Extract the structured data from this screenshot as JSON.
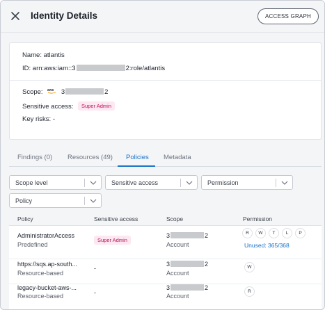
{
  "header": {
    "title": "Identity Details",
    "access_graph_label": "ACCESS GRAPH"
  },
  "identity": {
    "name_label": "Name:",
    "name_value": "atlantis",
    "id_label": "ID:",
    "id_prefix": "arn:aws:iam::3",
    "id_suffix": "2:role/atlantis",
    "scope_label": "Scope:",
    "scope_prefix": "3",
    "scope_suffix": "2",
    "sensitive_label": "Sensitive access:",
    "sensitive_badge": "Super Admin",
    "risks_label": "Key risks:",
    "risks_value": "-"
  },
  "tabs": [
    {
      "label": "Findings (0)",
      "active": false
    },
    {
      "label": "Resources (49)",
      "active": false
    },
    {
      "label": "Policies",
      "active": true
    },
    {
      "label": "Metadata",
      "active": false
    }
  ],
  "filters": [
    {
      "label": "Scope level"
    },
    {
      "label": "Sensitive access"
    },
    {
      "label": "Permission"
    },
    {
      "label": "Policy"
    }
  ],
  "table": {
    "columns": [
      "Policy",
      "Sensitive access",
      "Scope",
      "Permission"
    ],
    "rows": [
      {
        "policy": "AdministratorAccess",
        "type": "Predefined",
        "sensitive": "Super Admin",
        "scope_prefix": "3",
        "scope_suffix": "2",
        "scope_type": "Account",
        "permissions": [
          "R",
          "W",
          "T",
          "L",
          "P"
        ],
        "unused": "Unused: 365/368"
      },
      {
        "policy": "https://sqs.ap-south...",
        "type": "Resource-based",
        "sensitive": "-",
        "scope_prefix": "3",
        "scope_suffix": "2",
        "scope_type": "Account",
        "permissions": [
          "W"
        ]
      },
      {
        "policy": "legacy-bucket-aws-...",
        "type": "Resource-based",
        "sensitive": "-",
        "scope_prefix": "3",
        "scope_suffix": "2",
        "scope_type": "Account",
        "permissions": [
          "R"
        ]
      }
    ]
  },
  "colors": {
    "accent": "#1a73c9",
    "badge_bg": "#fde7f1",
    "badge_text": "#b8175c",
    "aws_orange": "#ff9900"
  },
  "icons": [
    "close-icon",
    "aws-logo",
    "chevron-down-icon"
  ]
}
